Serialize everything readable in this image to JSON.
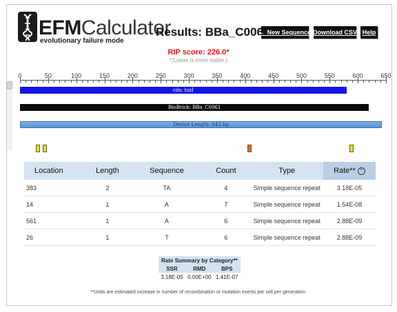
{
  "header": {
    "logo_bold": "EFM",
    "logo_light": "Calculator",
    "logo_subtitle": "evolutionary failure mode",
    "results_title": "Results: BBa_C0061",
    "new_sequence_label": "← New Sequence",
    "download_csv_label": "Download CSV",
    "help_label": "Help"
  },
  "rip": {
    "score_text": "RIP score: 226.0*",
    "note": "*(Lower is more stable.)"
  },
  "map": {
    "ruler_ticks": [
      "0",
      "50",
      "100",
      "150",
      "200",
      "250",
      "300",
      "350",
      "400",
      "450",
      "500",
      "550",
      "600",
      "650"
    ],
    "ruler_max": 650,
    "sequence_length": 643,
    "features": [
      {
        "label": "cds: luxI",
        "start": 0,
        "end": 580,
        "color": "#1414e8"
      },
      {
        "label": "BioBrick: BBa_C0061",
        "start": 0,
        "end": 620,
        "color": "#0a0a0a"
      },
      {
        "label": "Device Length: 643 bp",
        "start": 0,
        "end": 643,
        "color": "#5b95d6"
      }
    ],
    "markers": [
      {
        "position": 14,
        "color": "#f0e010"
      },
      {
        "position": 26,
        "color": "#f0e010"
      },
      {
        "position": 383,
        "color": "#e0701a"
      },
      {
        "position": 561,
        "color": "#f0e010"
      }
    ]
  },
  "table": {
    "columns": [
      "Location",
      "Length",
      "Sequence",
      "Count",
      "Type",
      "Rate**"
    ],
    "rows": [
      {
        "location": "383",
        "length": "2",
        "sequence": "TA",
        "count": "4",
        "type": "Simple sequence repeat",
        "rate": "3.18E-05"
      },
      {
        "location": "14",
        "length": "1",
        "sequence": "A",
        "count": "7",
        "type": "Simple sequence repeat",
        "rate": "1.54E-08"
      },
      {
        "location": "561",
        "length": "1",
        "sequence": "A",
        "count": "6",
        "type": "Simple sequence repeat",
        "rate": "2.88E-09"
      },
      {
        "location": "26",
        "length": "1",
        "sequence": "T",
        "count": "6",
        "type": "Simple sequence repeat",
        "rate": "2.88E-09"
      }
    ]
  },
  "summary": {
    "title": "Rate Summary by Category**",
    "columns": [
      "SSR",
      "RMD",
      "BPS"
    ],
    "values": [
      "3.18E-05",
      "0.00E+00",
      "1.41E-07"
    ]
  },
  "footnote": "**Units are estimated increase in number of recombination or mutation events per cell per generation.",
  "colors": {
    "rip_score": "#ee1111",
    "table_header": "#d3e3f2",
    "cds": "#1414e8",
    "biobrick": "#0a0a0a",
    "device": "#5b95d6"
  }
}
